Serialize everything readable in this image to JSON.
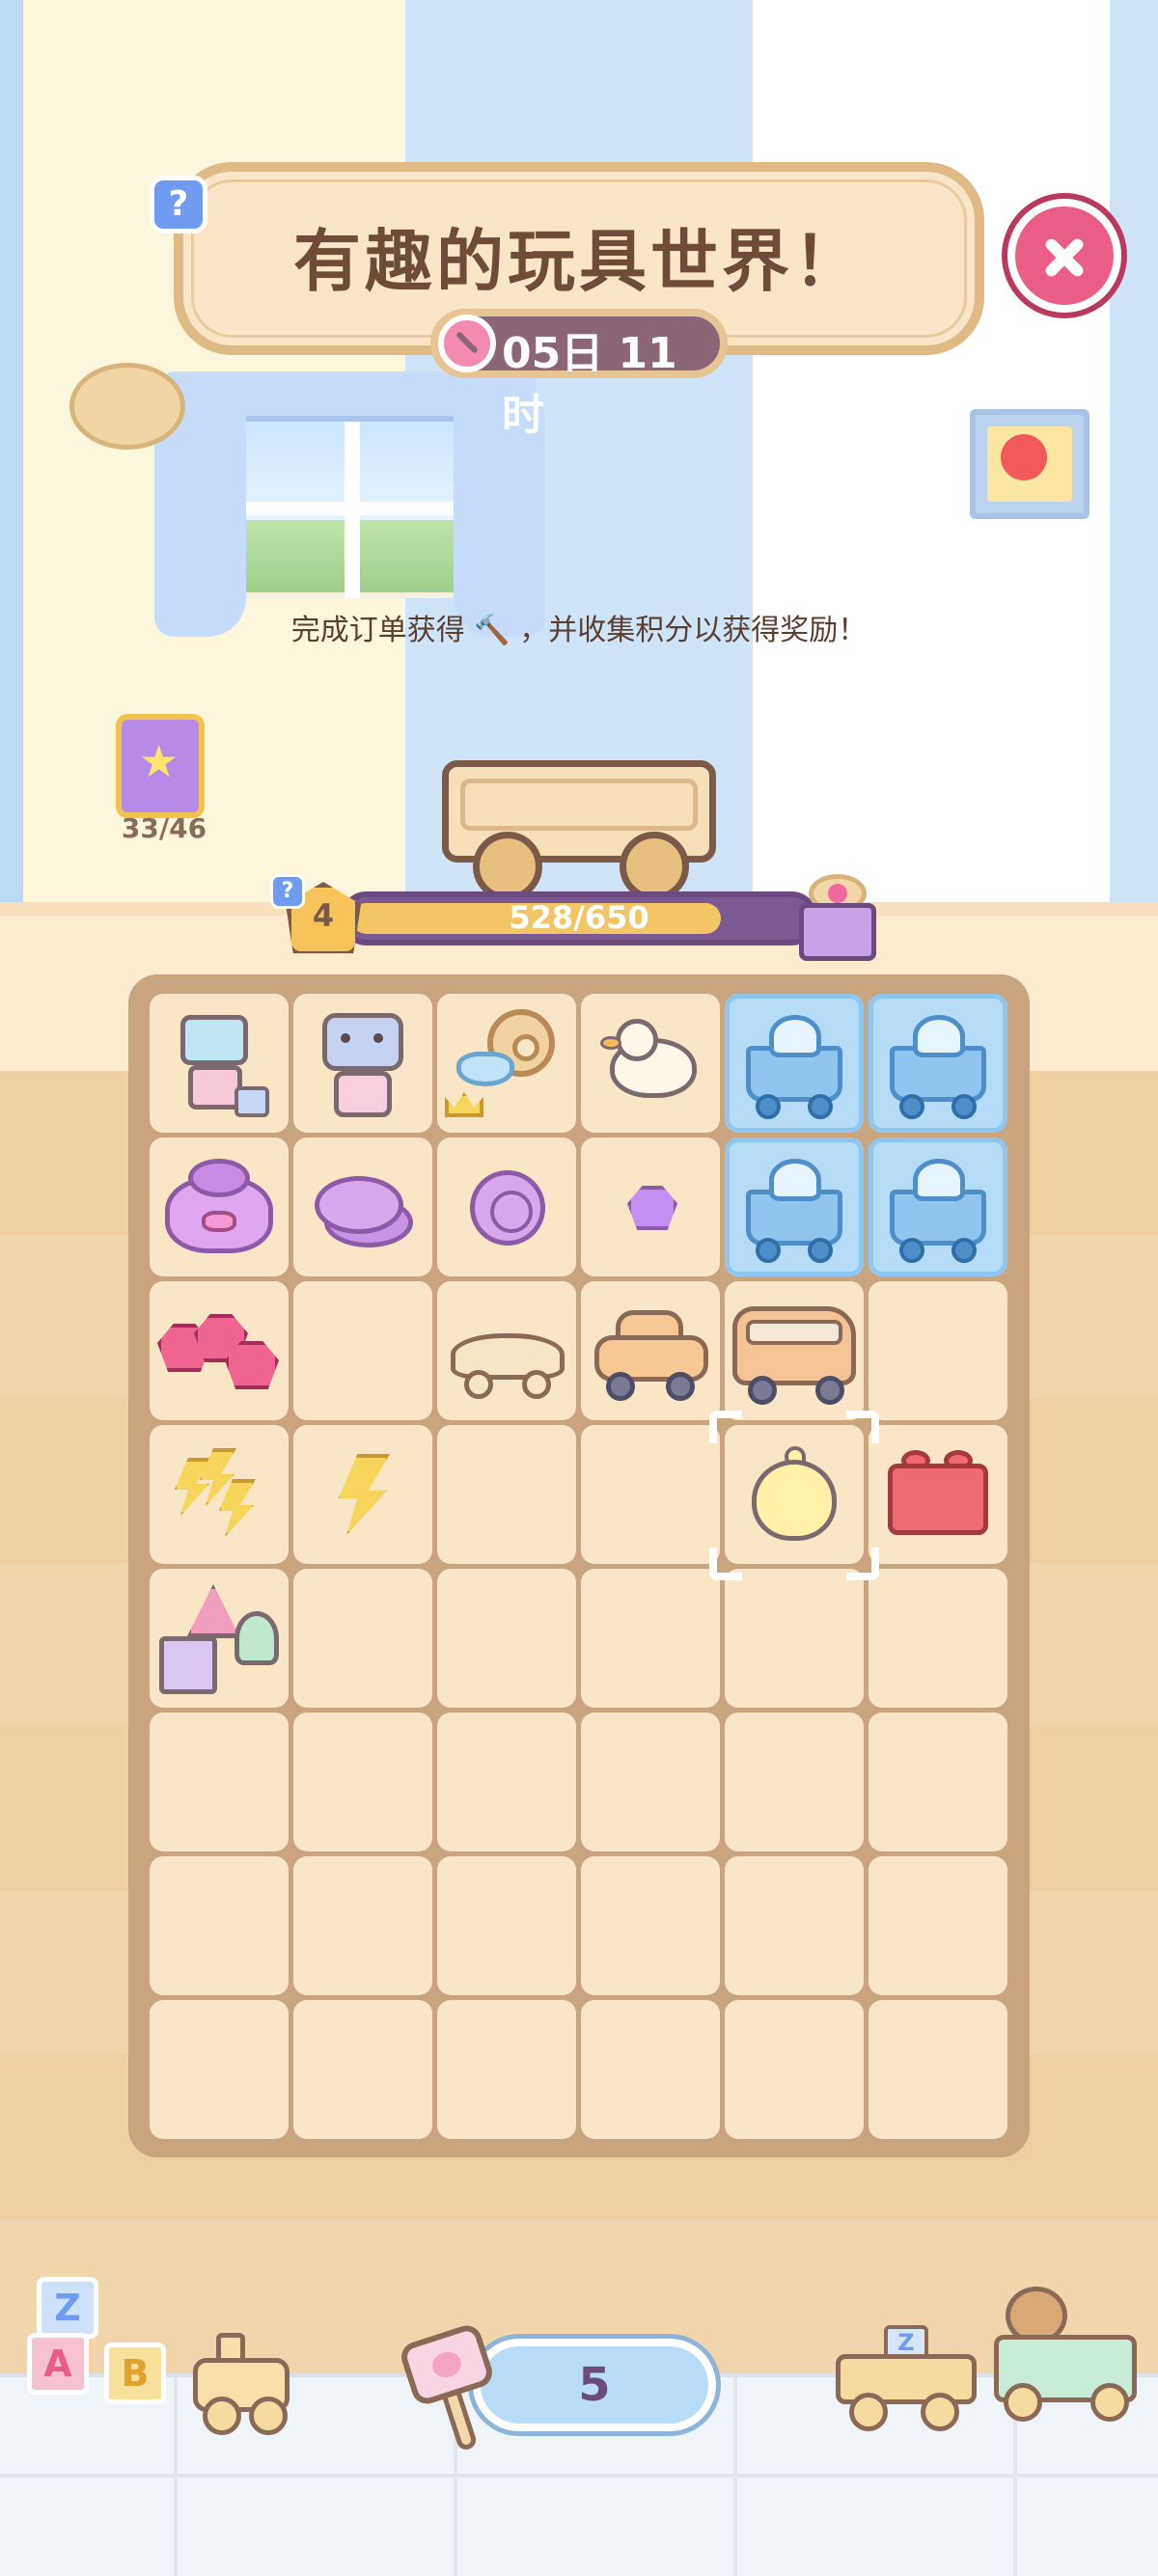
{
  "header": {
    "title": "有趣的玩具世界！",
    "timer": "05日 11时",
    "help_icon": "question-icon",
    "close_icon": "close-icon"
  },
  "info": {
    "text": "完成订单获得 🔨 ，并收集积分以获得奖励！"
  },
  "collection": {
    "count": "33/46",
    "icon": "star-book-icon"
  },
  "level": {
    "number": "4",
    "progress_text": "528/650",
    "current": 528,
    "max": 650,
    "reward_icon": "gift-box-icon"
  },
  "board": {
    "rows": [
      [
        "robot-small",
        "robot",
        "wind-up-key",
        "rubber-duck",
        "frozen-cart",
        "frozen-cart"
      ],
      [
        "purse",
        "coin-stack",
        "coin",
        "gem",
        "frozen-cart",
        "frozen-cart"
      ],
      [
        "rubies",
        "",
        "toy-car-outline",
        "toy-car",
        "toy-bus",
        ""
      ],
      [
        "lightning-bolts",
        "lightning-bolt",
        "",
        "",
        "chick",
        "lego-brick"
      ],
      [
        "toy-blocks",
        "",
        "",
        "",
        "",
        ""
      ],
      [
        "",
        "",
        "",
        "",
        "",
        ""
      ],
      [
        "",
        "",
        "",
        "",
        "",
        ""
      ],
      [
        "",
        "",
        "",
        "",
        "",
        ""
      ]
    ],
    "selected": {
      "row": 3,
      "col": 4
    }
  },
  "footer": {
    "hammer_count": "5",
    "hammer_icon": "mallet-icon",
    "blocks": [
      "Z",
      "A",
      "B"
    ],
    "truck_block": "Z"
  }
}
